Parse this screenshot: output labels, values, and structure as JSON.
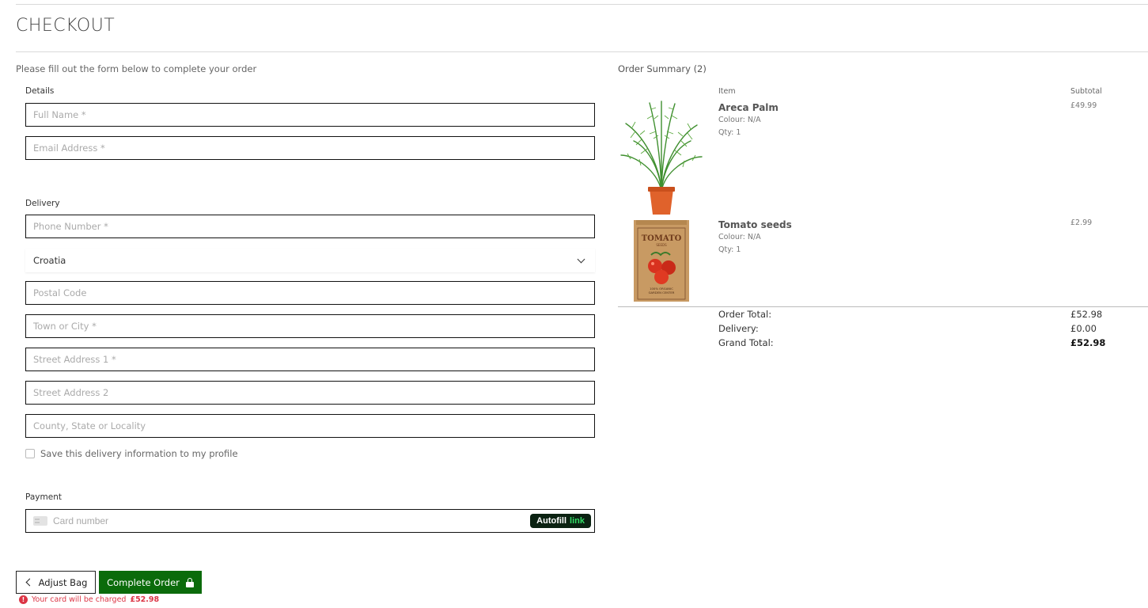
{
  "page": {
    "title": "CHECKOUT",
    "intro": "Please fill out the form below to complete your order"
  },
  "form": {
    "details_label": "Details",
    "full_name_placeholder": "Full Name *",
    "email_placeholder": "Email Address *",
    "delivery_label": "Delivery",
    "phone_placeholder": "Phone Number *",
    "country_value": "Croatia",
    "postal_placeholder": "Postal Code",
    "town_placeholder": "Town or City *",
    "street1_placeholder": "Street Address 1 *",
    "street2_placeholder": "Street Address 2",
    "county_placeholder": "County, State or Locality",
    "save_label": "Save this delivery information to my profile",
    "payment_label": "Payment",
    "card_placeholder": "Card number",
    "autofill_text": "Autofill",
    "autofill_link": "link"
  },
  "actions": {
    "adjust_label": "Adjust Bag",
    "complete_label": "Complete Order",
    "charge_text": "Your card will be charged",
    "charge_amount": "£52.98"
  },
  "summary": {
    "title": "Order Summary (2)",
    "col_item": "Item",
    "col_subtotal": "Subtotal",
    "items": [
      {
        "name": "Areca Palm",
        "colour": "Colour: N/A",
        "qty": "Qty: 1",
        "price": "£49.99"
      },
      {
        "name": "Tomato seeds",
        "colour": "Colour: N/A",
        "qty": "Qty: 1",
        "price": "£2.99"
      }
    ],
    "seed_packet": {
      "word": "TOMATO",
      "sub": "SEEDS",
      "footer1": "100% ORGANIC",
      "footer2": "GARDEN CENTER"
    },
    "order_total_label": "Order Total:",
    "order_total": "£52.98",
    "delivery_label": "Delivery:",
    "delivery": "£0.00",
    "grand_total_label": "Grand Total:",
    "grand_total": "£52.98"
  },
  "colors": {
    "complete_button": "#0b6b0b",
    "error": "#dc3545",
    "autofill_bg": "#0b2212",
    "autofill_link": "#33dd66"
  }
}
